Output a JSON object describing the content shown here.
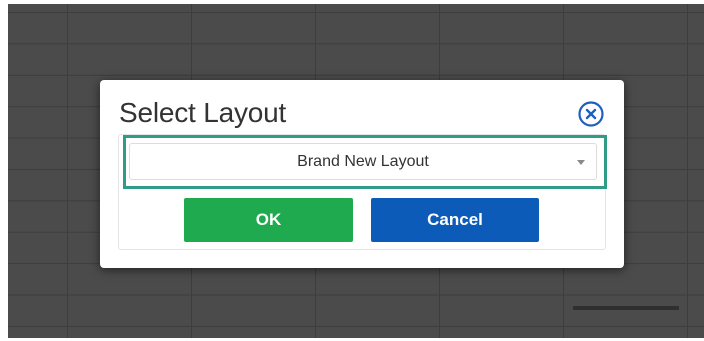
{
  "dialog": {
    "title": "Select Layout",
    "close_icon": "close-circle-icon",
    "layout_select": {
      "selected": "Brand New Layout"
    },
    "ok_label": "OK",
    "cancel_label": "Cancel"
  },
  "colors": {
    "backdrop": "#4b4b4b",
    "highlight_border": "#2e9c86",
    "ok_button": "#1faa4f",
    "cancel_button": "#0d5bb8",
    "close_icon": "#1f5fbf"
  }
}
